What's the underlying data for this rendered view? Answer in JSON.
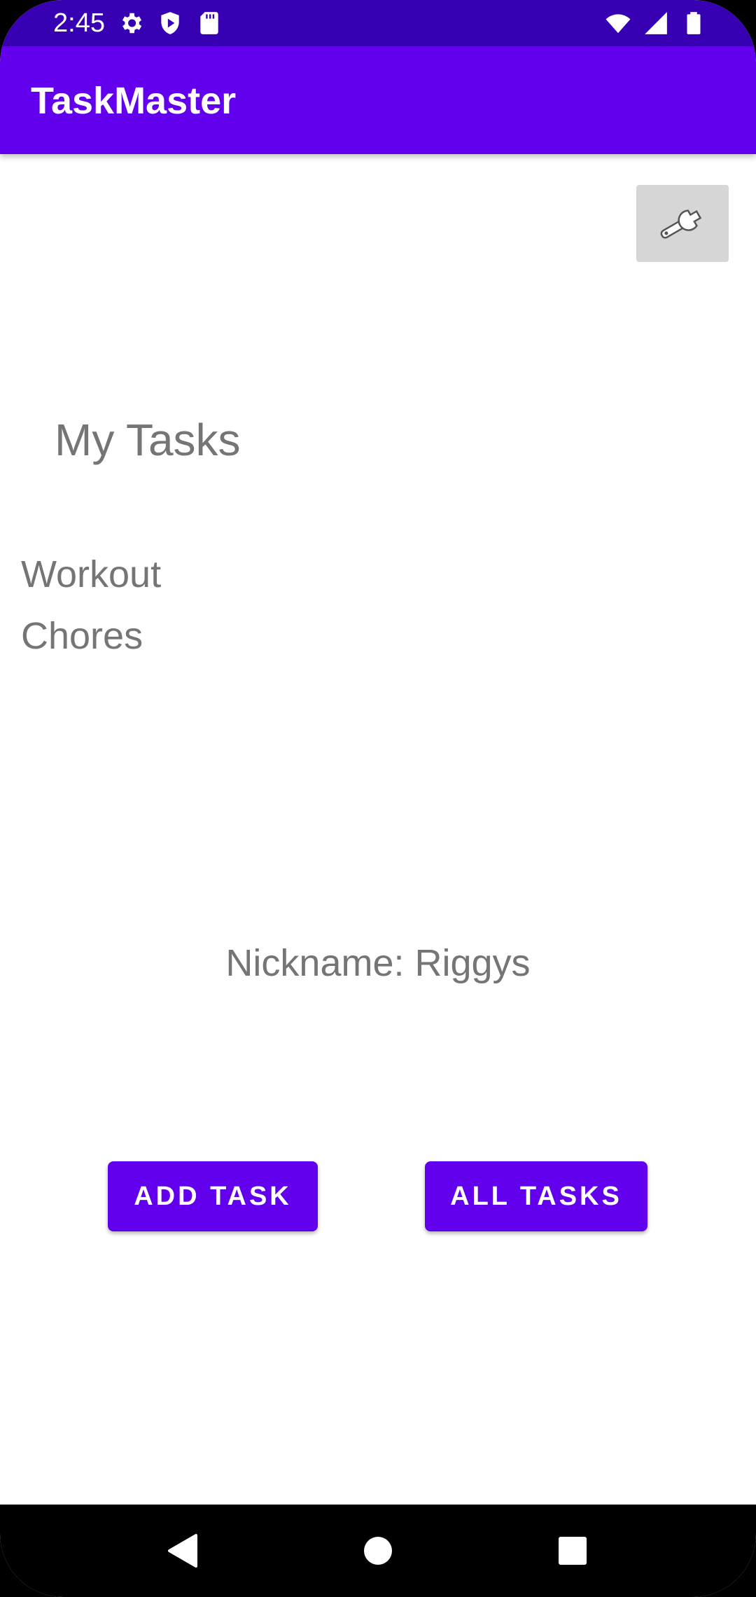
{
  "status_bar": {
    "time": "2:45",
    "left_icons": [
      "settings-icon",
      "shield-play-icon",
      "sd-card-icon"
    ],
    "right_icons": [
      "wifi-icon",
      "signal-icon",
      "battery-icon"
    ]
  },
  "app_bar": {
    "title": "TaskMaster"
  },
  "settings_button": {
    "icon": "wrench-icon"
  },
  "main": {
    "heading": "My Tasks",
    "tasks": [
      "Workout",
      "Chores"
    ],
    "nickname": "Nickname: Riggys"
  },
  "buttons": {
    "add_task": "ADD TASK",
    "all_tasks": "ALL TASKS"
  },
  "colors": {
    "status_bar": "#3700b3",
    "primary": "#6200ee",
    "text_secondary": "#757575"
  },
  "nav_bar": {
    "icons": [
      "back-icon",
      "home-icon",
      "recents-icon"
    ]
  }
}
